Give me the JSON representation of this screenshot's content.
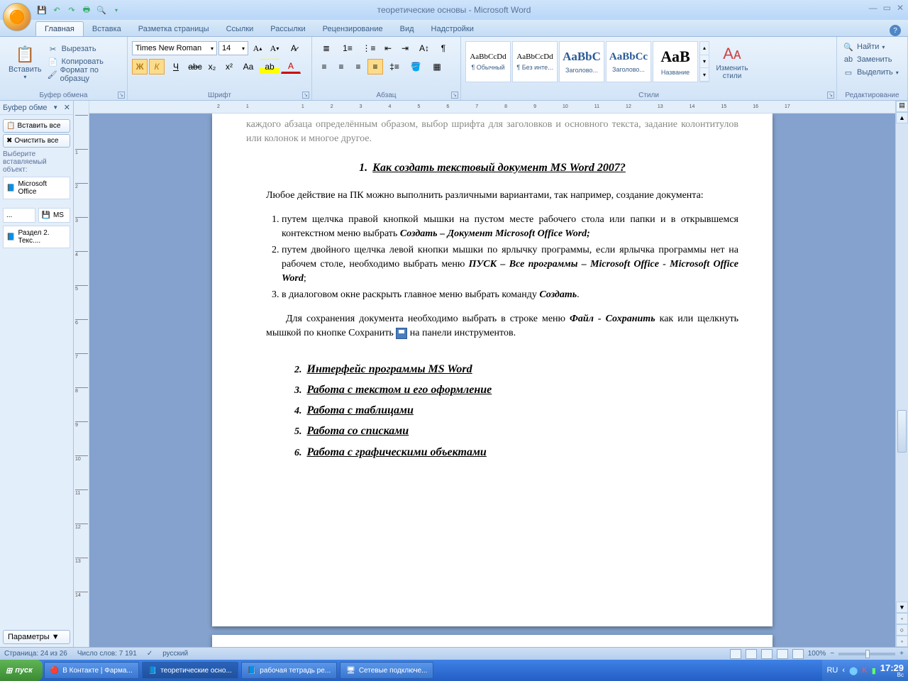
{
  "title": "теоретические основы - Microsoft Word",
  "qat_icons": [
    "save-icon",
    "undo-icon",
    "redo-icon",
    "print-icon",
    "preview-icon"
  ],
  "tabs": [
    "Главная",
    "Вставка",
    "Разметка страницы",
    "Ссылки",
    "Рассылки",
    "Рецензирование",
    "Вид",
    "Надстройки"
  ],
  "ribbon": {
    "clipboard": {
      "title": "Буфер обмена",
      "paste": "Вставить",
      "cut": "Вырезать",
      "copy": "Копировать",
      "painter": "Формат по образцу"
    },
    "font": {
      "title": "Шрифт",
      "name": "Times New Roman",
      "size": "14"
    },
    "paragraph": {
      "title": "Абзац"
    },
    "styles": {
      "title": "Стили",
      "change": "Изменить\nстили",
      "items": [
        {
          "prev": "AaBbCcDd",
          "label": "¶ Обычный",
          "style": "font-size:11px"
        },
        {
          "prev": "AaBbCcDd",
          "label": "¶ Без инте...",
          "style": "font-size:11px"
        },
        {
          "prev": "AaBbC",
          "label": "Заголово...",
          "style": "font-size:17px;color:#2a5a96;font-weight:bold"
        },
        {
          "prev": "AaBbCc",
          "label": "Заголово...",
          "style": "font-size:15px;color:#2a5a96;font-weight:bold"
        },
        {
          "prev": "АаВ",
          "label": "Название",
          "style": "font-size:22px;font-weight:bold"
        }
      ]
    },
    "editing": {
      "title": "Редактирование",
      "find": "Найти",
      "replace": "Заменить",
      "select": "Выделить"
    }
  },
  "clip_pane": {
    "title": "Буфер обме",
    "paste_all": "Вставить все",
    "clear_all": "Очистить все",
    "hint": "Выберите вставляемый объект:",
    "items": [
      "Microsoft Office",
      "...",
      "MS",
      "Раздел 2. Текс...."
    ],
    "params": "Параметры"
  },
  "hruler_ticks": [
    "2",
    "1",
    "",
    "1",
    "2",
    "3",
    "4",
    "5",
    "6",
    "7",
    "8",
    "9",
    "10",
    "11",
    "12",
    "13",
    "14",
    "15",
    "16",
    "17"
  ],
  "vruler_ticks": [
    "",
    "1",
    "2",
    "3",
    "4",
    "5",
    "6",
    "7",
    "8",
    "9",
    "10",
    "11",
    "12",
    "13",
    "14"
  ],
  "doc": {
    "cut_top": "каждого абзаца определённым образом, выбор шрифта для заголовков и основного текста, задание колонтитулов или колонок и многое другое.",
    "h1_num": "1.",
    "h1": "Как создать текстовый документ MS Word 2007?",
    "p_intro": "Любое действие на ПК можно выполнить различными вариантами, так например, создание документа:",
    "li1a": "путем щелчка правой кнопкой мышки на пустом месте рабочего стола или папки и в открывшемся контекстном меню выбрать ",
    "li1b": "Создать – Документ Microsoft  Office Word;",
    "li2a": "путем двойного щелчка левой кнопки мышки по ярлычку программы, если ярлычка программы нет на рабочем столе, необходимо выбрать меню ",
    "li2b": "ПУСК – Все программы – Microsoft  Office  -  Microsoft  Office Word",
    "li3a": "в диалоговом окне раскрыть главное меню  выбрать команду ",
    "li3b": "Создать",
    "p_save_a": "Для сохранения документа необходимо выбрать в строке меню ",
    "p_save_b": "Файл - Сохранить",
    "p_save_c": " как или щелкнуть мышкой по кнопке Сохранить ",
    "p_save_d": " на панели инструментов.",
    "heads": [
      {
        "n": "2.",
        "t": "Интерфейс программы MS Word"
      },
      {
        "n": "3.",
        "t": "Работа с текстом и его оформление"
      },
      {
        "n": "4.",
        "t": "Работа с таблицами"
      },
      {
        "n": "5.",
        "t": "Работа со списками"
      },
      {
        "n": "6.",
        "t": "Работа с графическими объектами"
      }
    ]
  },
  "status": {
    "page": "Страница: 24 из 26",
    "words": "Число слов: 7 191",
    "lang": "русский",
    "zoom": "100%"
  },
  "taskbar": {
    "start": "пуск",
    "lang": "RU",
    "time": "17:29",
    "day": "Вс",
    "tasks": [
      {
        "ico": "🔴",
        "t": "В Контакте | Фарма..."
      },
      {
        "ico": "📘",
        "t": "теоретические осно...",
        "active": true
      },
      {
        "ico": "📘",
        "t": "рабочая тетрадь ре..."
      },
      {
        "ico": "🖥",
        "t": "Сетевые подключе..."
      }
    ]
  }
}
